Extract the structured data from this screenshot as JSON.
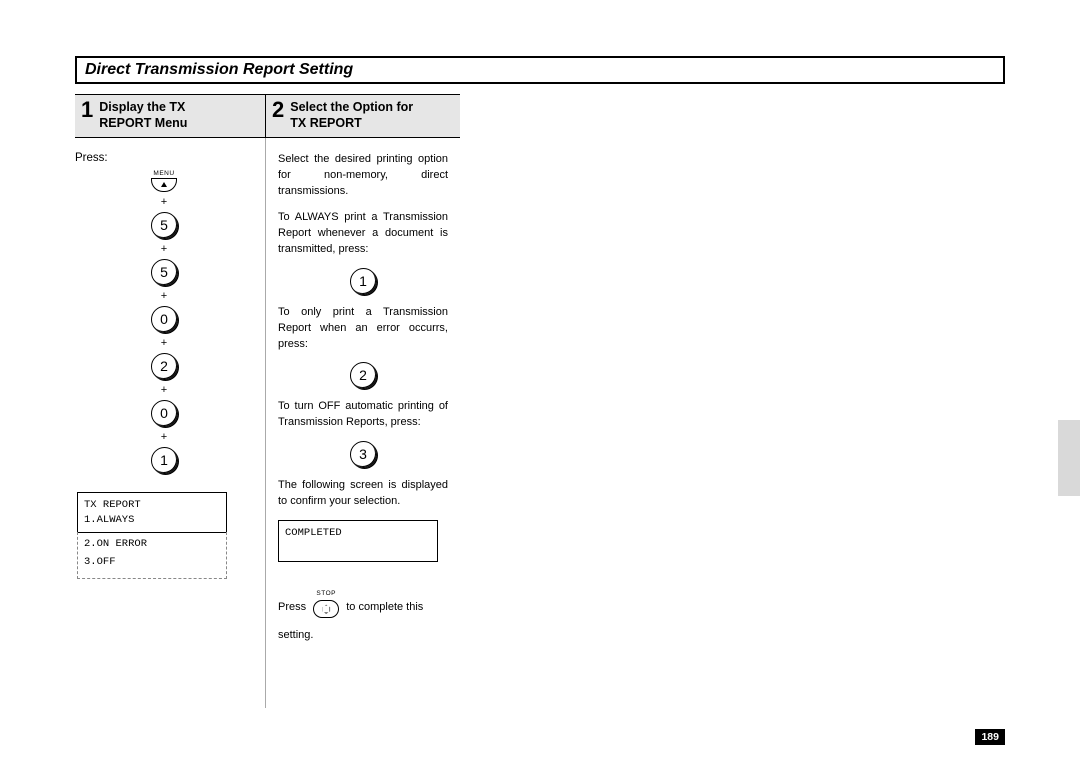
{
  "title": "Direct Transmission Report Setting",
  "page_number": "189",
  "step1": {
    "num": "1",
    "title_l1": "Display the TX",
    "title_l2": "REPORT Menu",
    "press": "Press:",
    "menu_label": "MENU",
    "keys": [
      "5",
      "5",
      "0",
      "2",
      "0",
      "1"
    ],
    "plus": "+",
    "lcd_line1": "TX REPORT",
    "lcd_line2": "1.ALWAYS",
    "lcd_line3": "2.ON ERROR",
    "lcd_line4": "3.OFF"
  },
  "step2": {
    "num": "2",
    "title_l1": "Select the Option for",
    "title_l2": "TX REPORT",
    "p1": "Select the desired printing option for non-memory, direct transmissions.",
    "p2": "To ALWAYS print a Transmission Report whenever a document is transmitted, press:",
    "k1": "1",
    "p3": "To only print a Transmission Report when an error occurrs, press:",
    "k2": "2",
    "p4": "To turn OFF automatic printing of Transmission Reports, press:",
    "k3": "3",
    "p5": "The following screen is displayed to confirm your selection.",
    "lcd": "COMPLETED",
    "stop_label": "STOP",
    "final_a": "Press",
    "final_b": "to complete this",
    "final_c": "setting."
  }
}
